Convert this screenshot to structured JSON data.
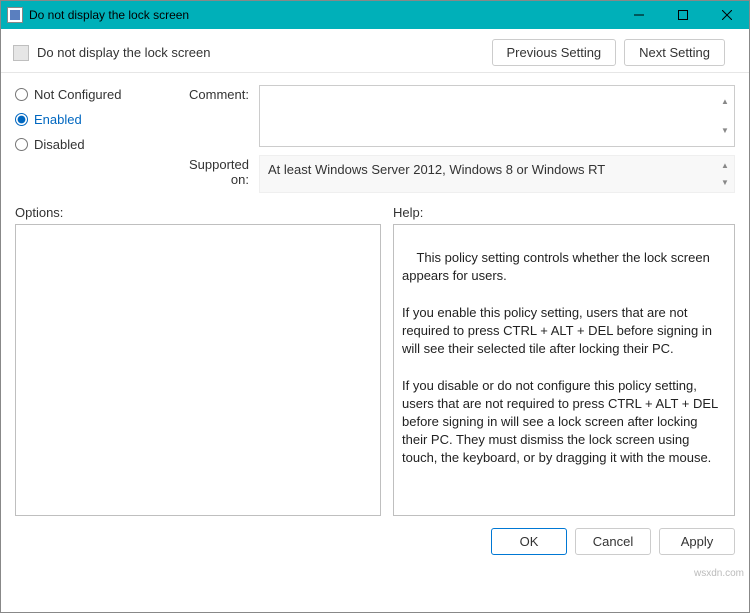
{
  "window": {
    "title": "Do not display the lock screen",
    "sub_title": "Do not display the lock screen"
  },
  "nav": {
    "previous": "Previous Setting",
    "next": "Next Setting"
  },
  "state": {
    "options": {
      "not_configured": "Not Configured",
      "enabled": "Enabled",
      "disabled": "Disabled"
    },
    "selected": "enabled"
  },
  "fields": {
    "comment_label": "Comment:",
    "comment_value": "",
    "supported_label": "Supported on:",
    "supported_value": "At least Windows Server 2012, Windows 8 or Windows RT"
  },
  "panes": {
    "options_label": "Options:",
    "help_label": "Help:",
    "options_text": "",
    "help_text": "This policy setting controls whether the lock screen appears for users.\n\nIf you enable this policy setting, users that are not required to press CTRL + ALT + DEL before signing in will see their selected tile after locking their PC.\n\nIf you disable or do not configure this policy setting, users that are not required to press CTRL + ALT + DEL before signing in will see a lock screen after locking their PC. They must dismiss the lock screen using touch, the keyboard, or by dragging it with the mouse."
  },
  "footer": {
    "ok": "OK",
    "cancel": "Cancel",
    "apply": "Apply"
  },
  "watermark": "wsxdn.com"
}
